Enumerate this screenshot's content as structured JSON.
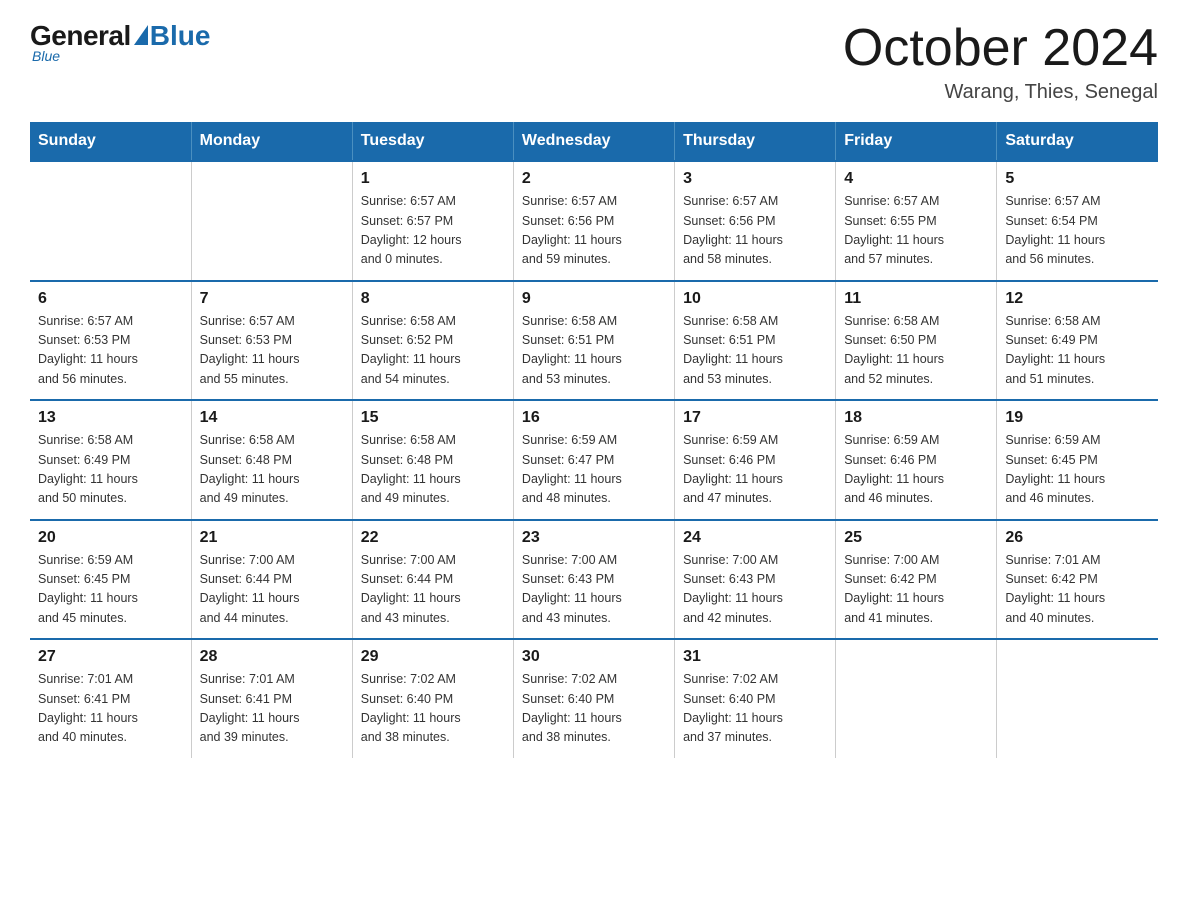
{
  "logo": {
    "general": "General",
    "blue": "Blue",
    "subtitle": "Blue"
  },
  "title": "October 2024",
  "location": "Warang, Thies, Senegal",
  "days_of_week": [
    "Sunday",
    "Monday",
    "Tuesday",
    "Wednesday",
    "Thursday",
    "Friday",
    "Saturday"
  ],
  "weeks": [
    [
      {
        "day": "",
        "info": ""
      },
      {
        "day": "",
        "info": ""
      },
      {
        "day": "1",
        "info": "Sunrise: 6:57 AM\nSunset: 6:57 PM\nDaylight: 12 hours\nand 0 minutes."
      },
      {
        "day": "2",
        "info": "Sunrise: 6:57 AM\nSunset: 6:56 PM\nDaylight: 11 hours\nand 59 minutes."
      },
      {
        "day": "3",
        "info": "Sunrise: 6:57 AM\nSunset: 6:56 PM\nDaylight: 11 hours\nand 58 minutes."
      },
      {
        "day": "4",
        "info": "Sunrise: 6:57 AM\nSunset: 6:55 PM\nDaylight: 11 hours\nand 57 minutes."
      },
      {
        "day": "5",
        "info": "Sunrise: 6:57 AM\nSunset: 6:54 PM\nDaylight: 11 hours\nand 56 minutes."
      }
    ],
    [
      {
        "day": "6",
        "info": "Sunrise: 6:57 AM\nSunset: 6:53 PM\nDaylight: 11 hours\nand 56 minutes."
      },
      {
        "day": "7",
        "info": "Sunrise: 6:57 AM\nSunset: 6:53 PM\nDaylight: 11 hours\nand 55 minutes."
      },
      {
        "day": "8",
        "info": "Sunrise: 6:58 AM\nSunset: 6:52 PM\nDaylight: 11 hours\nand 54 minutes."
      },
      {
        "day": "9",
        "info": "Sunrise: 6:58 AM\nSunset: 6:51 PM\nDaylight: 11 hours\nand 53 minutes."
      },
      {
        "day": "10",
        "info": "Sunrise: 6:58 AM\nSunset: 6:51 PM\nDaylight: 11 hours\nand 53 minutes."
      },
      {
        "day": "11",
        "info": "Sunrise: 6:58 AM\nSunset: 6:50 PM\nDaylight: 11 hours\nand 52 minutes."
      },
      {
        "day": "12",
        "info": "Sunrise: 6:58 AM\nSunset: 6:49 PM\nDaylight: 11 hours\nand 51 minutes."
      }
    ],
    [
      {
        "day": "13",
        "info": "Sunrise: 6:58 AM\nSunset: 6:49 PM\nDaylight: 11 hours\nand 50 minutes."
      },
      {
        "day": "14",
        "info": "Sunrise: 6:58 AM\nSunset: 6:48 PM\nDaylight: 11 hours\nand 49 minutes."
      },
      {
        "day": "15",
        "info": "Sunrise: 6:58 AM\nSunset: 6:48 PM\nDaylight: 11 hours\nand 49 minutes."
      },
      {
        "day": "16",
        "info": "Sunrise: 6:59 AM\nSunset: 6:47 PM\nDaylight: 11 hours\nand 48 minutes."
      },
      {
        "day": "17",
        "info": "Sunrise: 6:59 AM\nSunset: 6:46 PM\nDaylight: 11 hours\nand 47 minutes."
      },
      {
        "day": "18",
        "info": "Sunrise: 6:59 AM\nSunset: 6:46 PM\nDaylight: 11 hours\nand 46 minutes."
      },
      {
        "day": "19",
        "info": "Sunrise: 6:59 AM\nSunset: 6:45 PM\nDaylight: 11 hours\nand 46 minutes."
      }
    ],
    [
      {
        "day": "20",
        "info": "Sunrise: 6:59 AM\nSunset: 6:45 PM\nDaylight: 11 hours\nand 45 minutes."
      },
      {
        "day": "21",
        "info": "Sunrise: 7:00 AM\nSunset: 6:44 PM\nDaylight: 11 hours\nand 44 minutes."
      },
      {
        "day": "22",
        "info": "Sunrise: 7:00 AM\nSunset: 6:44 PM\nDaylight: 11 hours\nand 43 minutes."
      },
      {
        "day": "23",
        "info": "Sunrise: 7:00 AM\nSunset: 6:43 PM\nDaylight: 11 hours\nand 43 minutes."
      },
      {
        "day": "24",
        "info": "Sunrise: 7:00 AM\nSunset: 6:43 PM\nDaylight: 11 hours\nand 42 minutes."
      },
      {
        "day": "25",
        "info": "Sunrise: 7:00 AM\nSunset: 6:42 PM\nDaylight: 11 hours\nand 41 minutes."
      },
      {
        "day": "26",
        "info": "Sunrise: 7:01 AM\nSunset: 6:42 PM\nDaylight: 11 hours\nand 40 minutes."
      }
    ],
    [
      {
        "day": "27",
        "info": "Sunrise: 7:01 AM\nSunset: 6:41 PM\nDaylight: 11 hours\nand 40 minutes."
      },
      {
        "day": "28",
        "info": "Sunrise: 7:01 AM\nSunset: 6:41 PM\nDaylight: 11 hours\nand 39 minutes."
      },
      {
        "day": "29",
        "info": "Sunrise: 7:02 AM\nSunset: 6:40 PM\nDaylight: 11 hours\nand 38 minutes."
      },
      {
        "day": "30",
        "info": "Sunrise: 7:02 AM\nSunset: 6:40 PM\nDaylight: 11 hours\nand 38 minutes."
      },
      {
        "day": "31",
        "info": "Sunrise: 7:02 AM\nSunset: 6:40 PM\nDaylight: 11 hours\nand 37 minutes."
      },
      {
        "day": "",
        "info": ""
      },
      {
        "day": "",
        "info": ""
      }
    ]
  ]
}
